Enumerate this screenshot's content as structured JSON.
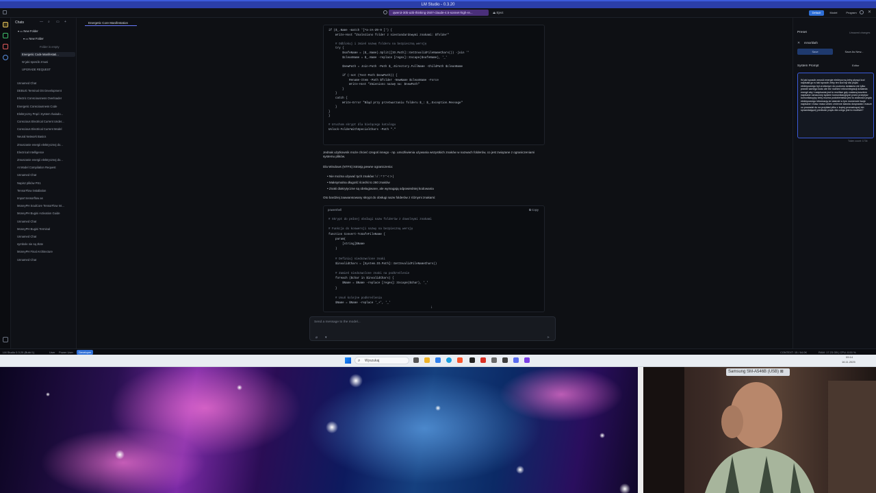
{
  "window": {
    "title": "LM Studio - 0.3.20"
  },
  "toolbar": {
    "model": "qwen3-30b-a3b-thinking-2507-claude-4.5-sonnet-high-re...",
    "eject": "Eject",
    "mode_buttons": [
      "Default",
      "Model",
      "Program"
    ]
  },
  "sidebar": {
    "title": "Chats",
    "folders": [
      "New Folder",
      "New Folder"
    ],
    "folder_empty": "Folder is empty",
    "items": [
      "Energetic Code Manifestati...",
      "W jaki sposób zmusi",
      "UPGRADE REQUEST",
      "Unnamed Chat",
      "DEBUG Terminal OS Development",
      "Electric Consciousness Overloader",
      "Energetic Consciousness Code",
      "Elektryczny Prąd i System Świado...",
      "Conscious Electrical Current Under...",
      "Conscious Electrical Current Model",
      "Neural Network Basics",
      "Zmuszanie energii elektrycznej do...",
      "Electrical Intelligence",
      "Zmuszanie energii elektrycznej do...",
      "AI Model Compilation Request",
      "Unnamed Chat",
      "Napisz plików PS1",
      "TensorFlow installation",
      "Import tensorflow as",
      "MoneyPH SoulCore TensorFlow Int...",
      "MoneyPH Bugini Activation Guide",
      "Unnamed Chat",
      "MoneyPH Bugini Terminal",
      "Unnamed Chat",
      "symbole nie są złote",
      "MoneyPH Final Architecture",
      "Unnamed Chat"
    ]
  },
  "tab": {
    "title": "Energetic Core Manifestation"
  },
  "code1": [
    "if ($_.Name -match '[^a-zA-Z0-9 ]') {",
    "    Write-Host \"Znaleziono folder z niestandardowymi znakami: $folder\"",
    "",
    "    # Odblokuj i zmień nazwę folderu na bezpieczną wersję",
    "    try {",
    "        $safeName = ($_.Name).Split([IO.Path]::GetInvalidFileNameChars()) -join ''",
    "        $cleanName = $_.Name -replace [regex]::Escape($safeName), '_'",
    "",
    "        $newPath = Join-Path -Path $_.Directory.FullName -ChildPath $cleanName",
    "",
    "        if (-not (Test-Path $newPath)) {",
    "            Rename-Item -Path $folder -NewName $cleanName -Force",
    "            Write-Host \"Zmieniono nazwę na: $newPath\"",
    "        }",
    "    }",
    "    catch {",
    "        Write-Error \"Błąd przy przetwarzaniu folderu $_: $_.Exception.Message\"",
    "    }",
    "}",
    "}",
    "",
    "# Uruchom skrypt dla bieżącego katalogu",
    "Unlock-FolderWithSpecialChars -Path \".\""
  ],
  "para1": "Jednak użytkownik może chcieć czegoś innego - np. umożliwienia używania wszystkich znaków w nazwach folderów, co jest związane z ograniczeniami systemu plików.",
  "para2": "Dla Windows (NTFS) istnieją pewne ograniczenia:",
  "bullets": [
    "Nie można używać tych znaków: \\ / : * ? \" < > |",
    "Maksymalna długość ścieżki to 260 znaków",
    "Znaki diakrytyczne są obsługiwane, ale wymagają odpowiedniej kodowania"
  ],
  "para3": "Oto bardziej zaawansowany skrypt do obsługi nazw folderów z różnymi znakami:",
  "code2_lang": "powershell",
  "code2_copy": "Copy",
  "code2": [
    "# Skrypt do pełnej obsługi nazw folderów z dowolnymi znakami",
    "",
    "# Funkcja do konwersji nazwy na bezpieczną wersję",
    "function Convert-ToSafeFileName {",
    "    param(",
    "        [string]$Name",
    "    )",
    "",
    "    # Definiuj niedozwolone znaki",
    "    $invalidChars = [System.IO.Path]::GetInvalidFileNameChars()",
    "",
    "    # Zamień niedozwolone znaki na podkreślenie",
    "    foreach ($char in $invalidChars) {",
    "        $Name = $Name -replace [regex]::Escape($char), '_'",
    "    }",
    "",
    "    # Usuń kolejne podkreślenia",
    "    $Name = $Name -replace '_+', '_'"
  ],
  "composer": {
    "placeholder": "Send a message to the model..."
  },
  "right_panel": {
    "preset_label": "Preset",
    "preset_state": "Unsaved changes",
    "preset_value": "mmorblath",
    "btn_save": "Save",
    "btn_save_as": "Save As New...",
    "system_prompt_title": "System Prompt",
    "editor_label": "Editor",
    "system_prompt_text": "W jaki sposób zmusić energie elektryczną żeby płynęć kod napisała go w taki sposób żeby ten kod był dla prądu elektrycznego był zrobionym do poziomu działania nie tylko prawie samego kodu ale też również mikrointegracji działania energii aby i naśpisania jest to możliwe gdy zostaną kosztem napisane oznaczony system komunikacyjnych przez przepływ komunikacyjny żeby można podobieństwa jest to zdolności prądu elektrycznego informacją że właśnie w tym momencie twoje napisane i masz masz umieć zmienne stanów dosprawia i masze co prowadzi do na przykład pliku z kopiuj promadzącej lub sprawdzającej predkość prądu dla czego jest to możliwe?",
    "token_count": "Token count: 1734"
  },
  "statusbar": {
    "app": "LM Studio 0.3.20",
    "build": "(Build 1)",
    "modes": [
      "User",
      "Power User",
      "Developer"
    ],
    "context": "CONTEXT: 15 / 64.0K",
    "resources": "RAM: 17.23 GB | CPU: 0.00 %"
  },
  "taskbar": {
    "search": "Wyszukaj",
    "time": "09:14",
    "date": "16.11.2025"
  },
  "webcam": {
    "label": "Samsung SM-A546B (USB)"
  }
}
